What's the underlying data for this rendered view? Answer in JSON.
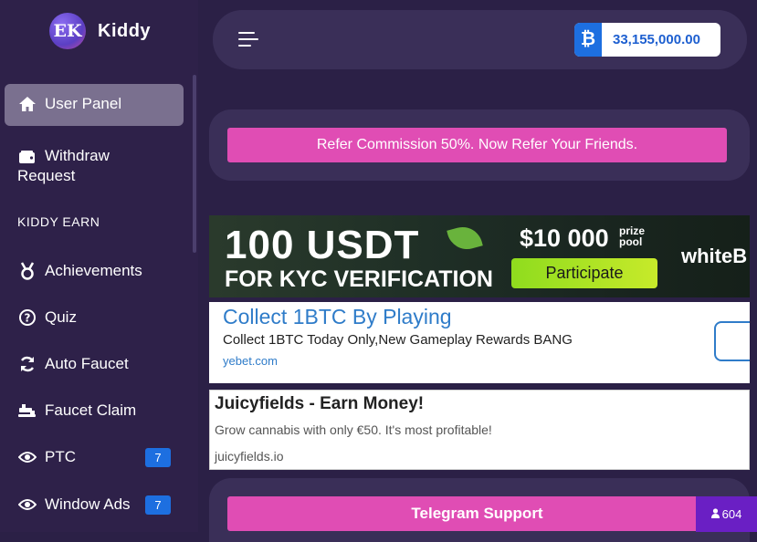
{
  "brand": {
    "logo_text": "EK",
    "name": "Kiddy"
  },
  "balance": {
    "currency_symbol": "₿",
    "value": "33,155,000.00"
  },
  "sidebar": {
    "items": [
      {
        "label": "User Panel",
        "icon": "home-icon"
      },
      {
        "label": "Withdraw",
        "label2": "Request",
        "icon": "wallet-icon"
      }
    ],
    "section_title": "KIDDY EARN",
    "earn_items": [
      {
        "label": "Achievements",
        "icon": "medal-icon"
      },
      {
        "label": "Quiz",
        "icon": "question-icon"
      },
      {
        "label": "Auto Faucet",
        "icon": "refresh-icon"
      },
      {
        "label": "Faucet Claim",
        "icon": "faucet-icon"
      },
      {
        "label": "PTC",
        "icon": "eye-icon",
        "badge": "7"
      },
      {
        "label": "Window Ads",
        "icon": "eye-icon",
        "badge": "7"
      }
    ]
  },
  "refer": {
    "text": "Refer Commission 50%. Now Refer Your Friends."
  },
  "banner": {
    "line1": "100 USDT",
    "line2": "FOR KYC VERIFICATION",
    "prize": "$10 000",
    "prize_word1": "prize",
    "prize_word2": "pool",
    "cta": "Participate",
    "brand": "whiteB"
  },
  "ad1": {
    "title": "Collect 1BTC By Playing",
    "desc": "Collect 1BTC Today Only,New Gameplay Rewards BANG",
    "url": "yebet.com"
  },
  "ad2": {
    "title": "Juicyfields - Earn Money!",
    "desc": "Grow cannabis with only €50. It's most profitable!",
    "url": "juicyfields.io"
  },
  "telegram": {
    "label": "Telegram Support"
  },
  "online": {
    "count": "604"
  },
  "colors": {
    "accent": "#e04db4",
    "blue": "#1d6fe0",
    "sidebar": "#2e2149",
    "card": "#3a2f58"
  }
}
